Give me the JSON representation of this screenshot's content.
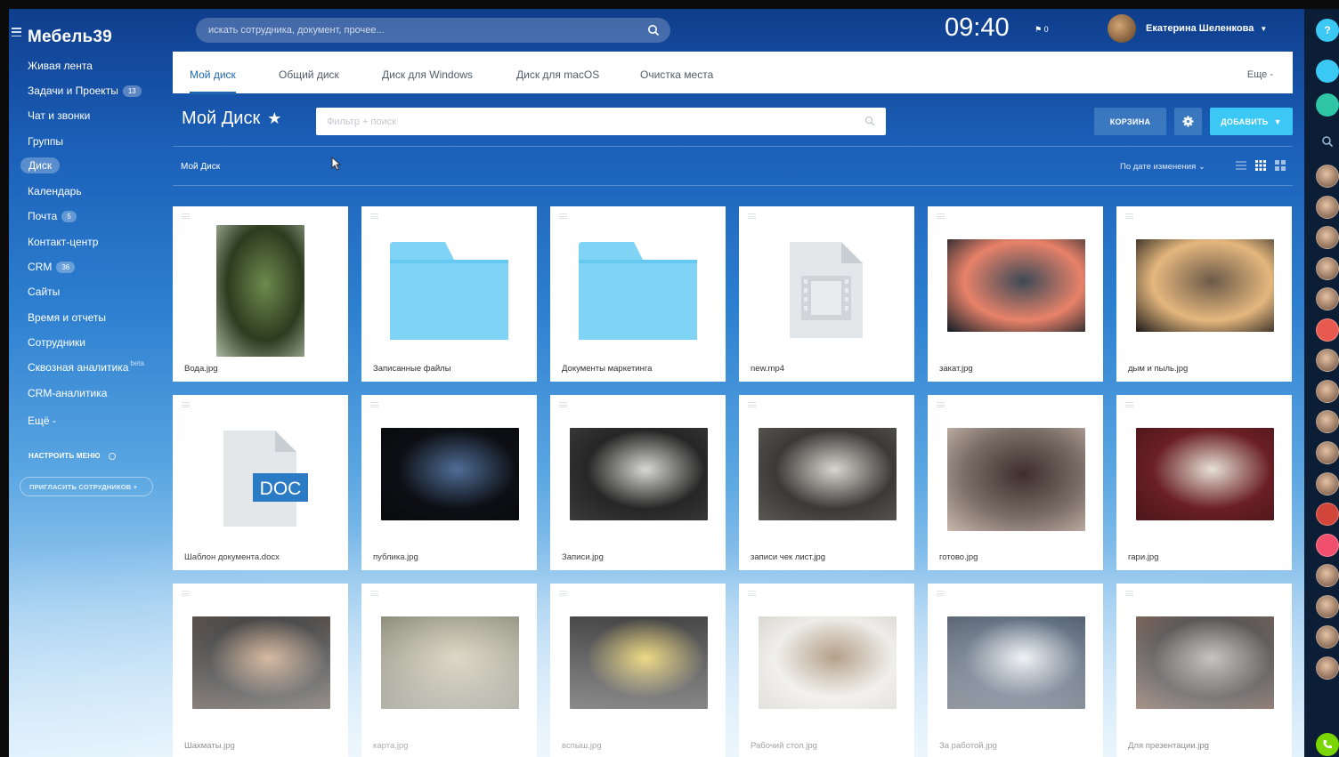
{
  "app": {
    "logo": "Мебель39",
    "clock": "09:40",
    "flag_count": "0"
  },
  "search": {
    "placeholder": "искать сотрудника, документ, прочее..."
  },
  "user": {
    "name": "Екатерина Шеленкова"
  },
  "sidebar": {
    "items": [
      {
        "label": "Живая лента"
      },
      {
        "label": "Задачи и Проекты",
        "badge": "13"
      },
      {
        "label": "Чат и звонки"
      },
      {
        "label": "Группы"
      },
      {
        "label": "Диск",
        "active": true
      },
      {
        "label": "Календарь"
      },
      {
        "label": "Почта",
        "badge": "5"
      },
      {
        "label": "Контакт-центр"
      },
      {
        "label": "CRM",
        "badge": "36"
      },
      {
        "label": "Сайты"
      },
      {
        "label": "Время и отчеты"
      },
      {
        "label": "Сотрудники"
      },
      {
        "label": "Сквозная аналитика",
        "sup": "beta"
      },
      {
        "label": "CRM-аналитика"
      },
      {
        "label": "Ещё -"
      }
    ],
    "config_label": "НАСТРОИТЬ МЕНЮ",
    "invite_label": "ПРИГЛАСИТЬ СОТРУДНИКОВ +"
  },
  "tabs": {
    "items": [
      "Мой диск",
      "Общий диск",
      "Диск для Windows",
      "Диск для macOS",
      "Очистка места"
    ],
    "more": "Еще -"
  },
  "toolbar": {
    "title": "Мой Диск",
    "filter_placeholder": "Фильтр + поиск",
    "trash_label": "КОРЗИНА",
    "add_label": "ДОБАВИТЬ"
  },
  "breadcrumb": "Мой Диск",
  "sort_label": "По дате изменения",
  "files": [
    {
      "name": "Вода.jpg",
      "kind": "photo-tall",
      "colors": [
        "#2d3b1f",
        "#6f8a4e",
        "#a8b7a0"
      ]
    },
    {
      "name": "Записанные файлы",
      "kind": "folder"
    },
    {
      "name": "Документы маркетинга",
      "kind": "folder"
    },
    {
      "name": "new.mp4",
      "kind": "video"
    },
    {
      "name": "закат.jpg",
      "kind": "photo",
      "colors": [
        "#e8826a",
        "#3c4a56",
        "#0f1c25"
      ]
    },
    {
      "name": "дым и пыль.jpg",
      "kind": "photo",
      "colors": [
        "#e5b77e",
        "#6b5a48",
        "#1c1a18"
      ]
    },
    {
      "name": "Шаблон документа.docx",
      "kind": "doc",
      "badge": "DOC"
    },
    {
      "name": "публика.jpg",
      "kind": "photo",
      "colors": [
        "#0d0f14",
        "#4f6d96",
        "#0a0a0c"
      ]
    },
    {
      "name": "Записи.jpg",
      "kind": "photo",
      "colors": [
        "#262626",
        "#d8d8d6",
        "#3b3b3b"
      ]
    },
    {
      "name": "записи чек лист.jpg",
      "kind": "photo",
      "colors": [
        "#3c3a37",
        "#d9d6cf",
        "#5a5853"
      ]
    },
    {
      "name": "готово.jpg",
      "kind": "photo-wide",
      "colors": [
        "#7a6e66",
        "#3d2e2c",
        "#c9b8ae"
      ]
    },
    {
      "name": "гари.jpg",
      "kind": "photo",
      "colors": [
        "#6a1f25",
        "#e7e1d6",
        "#4a161a"
      ]
    },
    {
      "name": "Шахматы.jpg",
      "kind": "photo",
      "colors": [
        "#1b1b1b",
        "#c49a76",
        "#3b2a1e"
      ]
    },
    {
      "name": "карта.jpg",
      "kind": "photo",
      "colors": [
        "#8d8b73",
        "#c8c1a4",
        "#646350"
      ]
    },
    {
      "name": "вспыш.jpg",
      "kind": "photo",
      "colors": [
        "#050505",
        "#e3c23a",
        "#0c0c0c"
      ]
    },
    {
      "name": "Рабочий стол.jpg",
      "kind": "photo",
      "colors": [
        "#e7e6e1",
        "#8a6a46",
        "#c7c3b9"
      ]
    },
    {
      "name": "За работой.jpg",
      "kind": "photo",
      "colors": [
        "#3e4f64",
        "#e9eef2",
        "#2e3a49"
      ]
    },
    {
      "name": "Для презентации.jpg",
      "kind": "photo",
      "colors": [
        "#3e3a3a",
        "#b6b4ad",
        "#6e4d3c"
      ]
    }
  ]
}
